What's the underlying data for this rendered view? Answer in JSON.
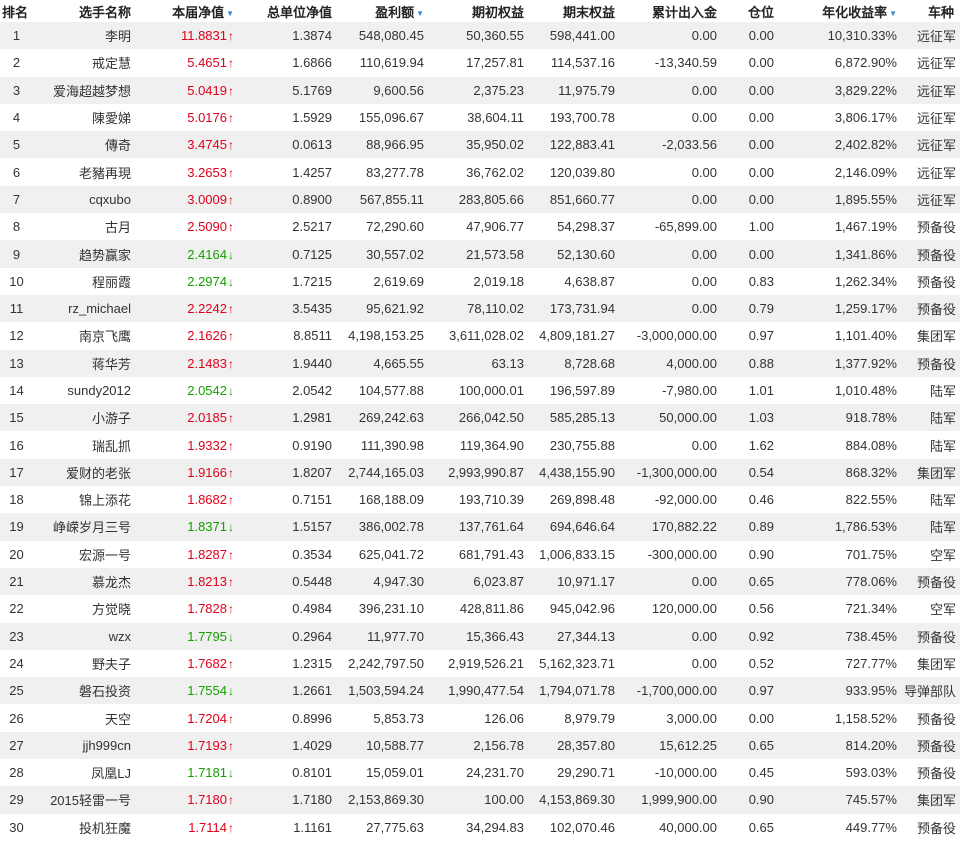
{
  "colors": {
    "up": "#e0001b",
    "down": "#16a000",
    "sort_icon": "#3a86d0",
    "row_alt": "#f0f0f0"
  },
  "header": {
    "rank": "排名",
    "name": "选手名称",
    "nav": "本届净值",
    "total_nav": "总单位净值",
    "profit": "盈利额",
    "start_equity": "期初权益",
    "end_equity": "期末权益",
    "flow": "累计出入金",
    "position": "仓位",
    "annual": "年化收益率",
    "type": "车种"
  },
  "rows": [
    {
      "rank": "1",
      "name": "李明",
      "nav": "11.8831",
      "dir": "up",
      "total_nav": "1.3874",
      "profit": "548,080.45",
      "start": "50,360.55",
      "end": "598,441.00",
      "flow": "0.00",
      "pos": "0.00",
      "annual": "10,310.33%",
      "type": "远征军"
    },
    {
      "rank": "2",
      "name": "戒定慧",
      "nav": "5.4651",
      "dir": "up",
      "total_nav": "1.6866",
      "profit": "110,619.94",
      "start": "17,257.81",
      "end": "114,537.16",
      "flow": "-13,340.59",
      "pos": "0.00",
      "annual": "6,872.90%",
      "type": "远征军"
    },
    {
      "rank": "3",
      "name": "爱海超越梦想",
      "nav": "5.0419",
      "dir": "up",
      "total_nav": "5.1769",
      "profit": "9,600.56",
      "start": "2,375.23",
      "end": "11,975.79",
      "flow": "0.00",
      "pos": "0.00",
      "annual": "3,829.22%",
      "type": "远征军"
    },
    {
      "rank": "4",
      "name": "陳愛娣",
      "nav": "5.0176",
      "dir": "up",
      "total_nav": "1.5929",
      "profit": "155,096.67",
      "start": "38,604.11",
      "end": "193,700.78",
      "flow": "0.00",
      "pos": "0.00",
      "annual": "3,806.17%",
      "type": "远征军"
    },
    {
      "rank": "5",
      "name": "傳奇",
      "nav": "3.4745",
      "dir": "up",
      "total_nav": "0.0613",
      "profit": "88,966.95",
      "start": "35,950.02",
      "end": "122,883.41",
      "flow": "-2,033.56",
      "pos": "0.00",
      "annual": "2,402.82%",
      "type": "远征军"
    },
    {
      "rank": "6",
      "name": "老豬再現",
      "nav": "3.2653",
      "dir": "up",
      "total_nav": "1.4257",
      "profit": "83,277.78",
      "start": "36,762.02",
      "end": "120,039.80",
      "flow": "0.00",
      "pos": "0.00",
      "annual": "2,146.09%",
      "type": "远征军"
    },
    {
      "rank": "7",
      "name": "cqxubo",
      "nav": "3.0009",
      "dir": "up",
      "total_nav": "0.8900",
      "profit": "567,855.11",
      "start": "283,805.66",
      "end": "851,660.77",
      "flow": "0.00",
      "pos": "0.00",
      "annual": "1,895.55%",
      "type": "远征军"
    },
    {
      "rank": "8",
      "name": "古月",
      "nav": "2.5090",
      "dir": "up",
      "total_nav": "2.5217",
      "profit": "72,290.60",
      "start": "47,906.77",
      "end": "54,298.37",
      "flow": "-65,899.00",
      "pos": "1.00",
      "annual": "1,467.19%",
      "type": "预备役"
    },
    {
      "rank": "9",
      "name": "趋势赢家",
      "nav": "2.4164",
      "dir": "down",
      "total_nav": "0.7125",
      "profit": "30,557.02",
      "start": "21,573.58",
      "end": "52,130.60",
      "flow": "0.00",
      "pos": "0.00",
      "annual": "1,341.86%",
      "type": "预备役"
    },
    {
      "rank": "10",
      "name": "程丽霞",
      "nav": "2.2974",
      "dir": "down",
      "total_nav": "1.7215",
      "profit": "2,619.69",
      "start": "2,019.18",
      "end": "4,638.87",
      "flow": "0.00",
      "pos": "0.83",
      "annual": "1,262.34%",
      "type": "预备役"
    },
    {
      "rank": "11",
      "name": "rz_michael",
      "nav": "2.2242",
      "dir": "up",
      "total_nav": "3.5435",
      "profit": "95,621.92",
      "start": "78,110.02",
      "end": "173,731.94",
      "flow": "0.00",
      "pos": "0.79",
      "annual": "1,259.17%",
      "type": "预备役"
    },
    {
      "rank": "12",
      "name": "南京飞鹰",
      "nav": "2.1626",
      "dir": "up",
      "total_nav": "8.8511",
      "profit": "4,198,153.25",
      "start": "3,611,028.02",
      "end": "4,809,181.27",
      "flow": "-3,000,000.00",
      "pos": "0.97",
      "annual": "1,101.40%",
      "type": "集团军"
    },
    {
      "rank": "13",
      "name": "蒋华芳",
      "nav": "2.1483",
      "dir": "up",
      "total_nav": "1.9440",
      "profit": "4,665.55",
      "start": "63.13",
      "end": "8,728.68",
      "flow": "4,000.00",
      "pos": "0.88",
      "annual": "1,377.92%",
      "type": "预备役"
    },
    {
      "rank": "14",
      "name": "sundy2012",
      "nav": "2.0542",
      "dir": "down",
      "total_nav": "2.0542",
      "profit": "104,577.88",
      "start": "100,000.01",
      "end": "196,597.89",
      "flow": "-7,980.00",
      "pos": "1.01",
      "annual": "1,010.48%",
      "type": "陆军"
    },
    {
      "rank": "15",
      "name": "小游子",
      "nav": "2.0185",
      "dir": "up",
      "total_nav": "1.2981",
      "profit": "269,242.63",
      "start": "266,042.50",
      "end": "585,285.13",
      "flow": "50,000.00",
      "pos": "1.03",
      "annual": "918.78%",
      "type": "陆军"
    },
    {
      "rank": "16",
      "name": "瑞乱抓",
      "nav": "1.9332",
      "dir": "up",
      "total_nav": "0.9190",
      "profit": "111,390.98",
      "start": "119,364.90",
      "end": "230,755.88",
      "flow": "0.00",
      "pos": "1.62",
      "annual": "884.08%",
      "type": "陆军"
    },
    {
      "rank": "17",
      "name": "爱财的老张",
      "nav": "1.9166",
      "dir": "up",
      "total_nav": "1.8207",
      "profit": "2,744,165.03",
      "start": "2,993,990.87",
      "end": "4,438,155.90",
      "flow": "-1,300,000.00",
      "pos": "0.54",
      "annual": "868.32%",
      "type": "集团军"
    },
    {
      "rank": "18",
      "name": "锦上添花",
      "nav": "1.8682",
      "dir": "up",
      "total_nav": "0.7151",
      "profit": "168,188.09",
      "start": "193,710.39",
      "end": "269,898.48",
      "flow": "-92,000.00",
      "pos": "0.46",
      "annual": "822.55%",
      "type": "陆军"
    },
    {
      "rank": "19",
      "name": "峥嵘岁月三号",
      "nav": "1.8371",
      "dir": "down",
      "total_nav": "1.5157",
      "profit": "386,002.78",
      "start": "137,761.64",
      "end": "694,646.64",
      "flow": "170,882.22",
      "pos": "0.89",
      "annual": "1,786.53%",
      "type": "陆军"
    },
    {
      "rank": "20",
      "name": "宏源一号",
      "nav": "1.8287",
      "dir": "up",
      "total_nav": "0.3534",
      "profit": "625,041.72",
      "start": "681,791.43",
      "end": "1,006,833.15",
      "flow": "-300,000.00",
      "pos": "0.90",
      "annual": "701.75%",
      "type": "空军"
    },
    {
      "rank": "21",
      "name": "慕龙杰",
      "nav": "1.8213",
      "dir": "up",
      "total_nav": "0.5448",
      "profit": "4,947.30",
      "start": "6,023.87",
      "end": "10,971.17",
      "flow": "0.00",
      "pos": "0.65",
      "annual": "778.06%",
      "type": "预备役"
    },
    {
      "rank": "22",
      "name": "方觉晓",
      "nav": "1.7828",
      "dir": "up",
      "total_nav": "0.4984",
      "profit": "396,231.10",
      "start": "428,811.86",
      "end": "945,042.96",
      "flow": "120,000.00",
      "pos": "0.56",
      "annual": "721.34%",
      "type": "空军"
    },
    {
      "rank": "23",
      "name": "wzx",
      "nav": "1.7795",
      "dir": "down",
      "total_nav": "0.2964",
      "profit": "11,977.70",
      "start": "15,366.43",
      "end": "27,344.13",
      "flow": "0.00",
      "pos": "0.92",
      "annual": "738.45%",
      "type": "预备役"
    },
    {
      "rank": "24",
      "name": "野夫子",
      "nav": "1.7682",
      "dir": "up",
      "total_nav": "1.2315",
      "profit": "2,242,797.50",
      "start": "2,919,526.21",
      "end": "5,162,323.71",
      "flow": "0.00",
      "pos": "0.52",
      "annual": "727.77%",
      "type": "集团军"
    },
    {
      "rank": "25",
      "name": "磐石投资",
      "nav": "1.7554",
      "dir": "down",
      "total_nav": "1.2661",
      "profit": "1,503,594.24",
      "start": "1,990,477.54",
      "end": "1,794,071.78",
      "flow": "-1,700,000.00",
      "pos": "0.97",
      "annual": "933.95%",
      "type": "导弹部队"
    },
    {
      "rank": "26",
      "name": "天空",
      "nav": "1.7204",
      "dir": "up",
      "total_nav": "0.8996",
      "profit": "5,853.73",
      "start": "126.06",
      "end": "8,979.79",
      "flow": "3,000.00",
      "pos": "0.00",
      "annual": "1,158.52%",
      "type": "预备役"
    },
    {
      "rank": "27",
      "name": "jjh999cn",
      "nav": "1.7193",
      "dir": "up",
      "total_nav": "1.4029",
      "profit": "10,588.77",
      "start": "2,156.78",
      "end": "28,357.80",
      "flow": "15,612.25",
      "pos": "0.65",
      "annual": "814.20%",
      "type": "预备役"
    },
    {
      "rank": "28",
      "name": "凤凰LJ",
      "nav": "1.7181",
      "dir": "down",
      "total_nav": "0.8101",
      "profit": "15,059.01",
      "start": "24,231.70",
      "end": "29,290.71",
      "flow": "-10,000.00",
      "pos": "0.45",
      "annual": "593.03%",
      "type": "预备役"
    },
    {
      "rank": "29",
      "name": "2015轻雷一号",
      "nav": "1.7180",
      "dir": "up",
      "total_nav": "1.7180",
      "profit": "2,153,869.30",
      "start": "100.00",
      "end": "4,153,869.30",
      "flow": "1,999,900.00",
      "pos": "0.90",
      "annual": "745.57%",
      "type": "集团军"
    },
    {
      "rank": "30",
      "name": "投机狂魔",
      "nav": "1.7114",
      "dir": "up",
      "total_nav": "1.1161",
      "profit": "27,775.63",
      "start": "34,294.83",
      "end": "102,070.46",
      "flow": "40,000.00",
      "pos": "0.65",
      "annual": "449.77%",
      "type": "预备役"
    }
  ]
}
